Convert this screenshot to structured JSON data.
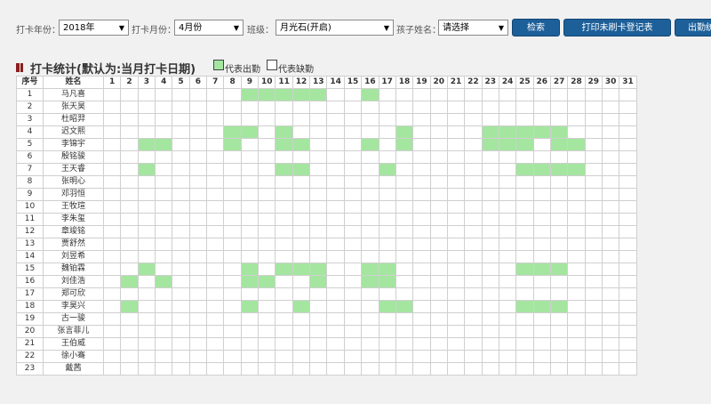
{
  "toolbar": {
    "year_label": "打卡年份：",
    "year_value": "2018年",
    "month_label": "打卡月份：",
    "month_value": "4月份",
    "class_label": "班级：",
    "class_value": "月光石(开启)",
    "child_label": "孩子姓名：",
    "child_value": "请选择",
    "search_label": "检索",
    "print_label": "打印未刷卡登记表",
    "attendance_label": "出勤统"
  },
  "section": {
    "title": "打卡统计(默认为:当月打卡日期)",
    "legend_present": "代表出勤",
    "legend_absent": "代表缺勤"
  },
  "colors": {
    "present": "#a4e6a0",
    "button": "#1d5f99",
    "title_mark": "#8b1e1e"
  },
  "table": {
    "header_seq": "序号",
    "header_name": "姓名",
    "days": [
      "1",
      "2",
      "3",
      "4",
      "5",
      "6",
      "7",
      "8",
      "9",
      "10",
      "11",
      "12",
      "13",
      "14",
      "15",
      "16",
      "17",
      "18",
      "19",
      "20",
      "21",
      "22",
      "23",
      "24",
      "25",
      "26",
      "27",
      "28",
      "29",
      "30",
      "31"
    ],
    "rows": [
      {
        "seq": "1",
        "name": "马凡喜",
        "present": [
          9,
          10,
          11,
          12,
          13,
          16
        ]
      },
      {
        "seq": "2",
        "name": "张天昊",
        "present": []
      },
      {
        "seq": "3",
        "name": "杜昭羿",
        "present": []
      },
      {
        "seq": "4",
        "name": "迟文熙",
        "present": [
          8,
          9,
          11,
          18,
          23,
          24,
          25,
          26,
          27
        ]
      },
      {
        "seq": "5",
        "name": "李锦宇",
        "present": [
          3,
          4,
          8,
          11,
          12,
          16,
          18,
          23,
          24,
          25,
          27,
          28
        ]
      },
      {
        "seq": "6",
        "name": "殷铭骏",
        "present": []
      },
      {
        "seq": "7",
        "name": "王天睿",
        "present": [
          3,
          11,
          12,
          17,
          25,
          26,
          27,
          28
        ]
      },
      {
        "seq": "8",
        "name": "张明心",
        "present": []
      },
      {
        "seq": "9",
        "name": "邓羽恒",
        "present": []
      },
      {
        "seq": "10",
        "name": "王牧瑄",
        "present": []
      },
      {
        "seq": "11",
        "name": "李朱玺",
        "present": []
      },
      {
        "seq": "12",
        "name": "章竣铭",
        "present": []
      },
      {
        "seq": "13",
        "name": "贾舒然",
        "present": []
      },
      {
        "seq": "14",
        "name": "刘昱希",
        "present": []
      },
      {
        "seq": "15",
        "name": "魏铂霖",
        "present": [
          3,
          9,
          11,
          12,
          13,
          16,
          17,
          25,
          26,
          27
        ]
      },
      {
        "seq": "16",
        "name": "刘佳浩",
        "present": [
          2,
          4,
          9,
          10,
          13,
          16,
          17
        ]
      },
      {
        "seq": "17",
        "name": "郑可欣",
        "present": []
      },
      {
        "seq": "18",
        "name": "李昊兴",
        "present": [
          2,
          9,
          12,
          17,
          18,
          25,
          26,
          27
        ]
      },
      {
        "seq": "19",
        "name": "古一骏",
        "present": []
      },
      {
        "seq": "20",
        "name": "张言菲儿",
        "present": []
      },
      {
        "seq": "21",
        "name": "王伯威",
        "present": []
      },
      {
        "seq": "22",
        "name": "徐小骞",
        "present": []
      },
      {
        "seq": "23",
        "name": "戴茜",
        "present": []
      }
    ]
  }
}
